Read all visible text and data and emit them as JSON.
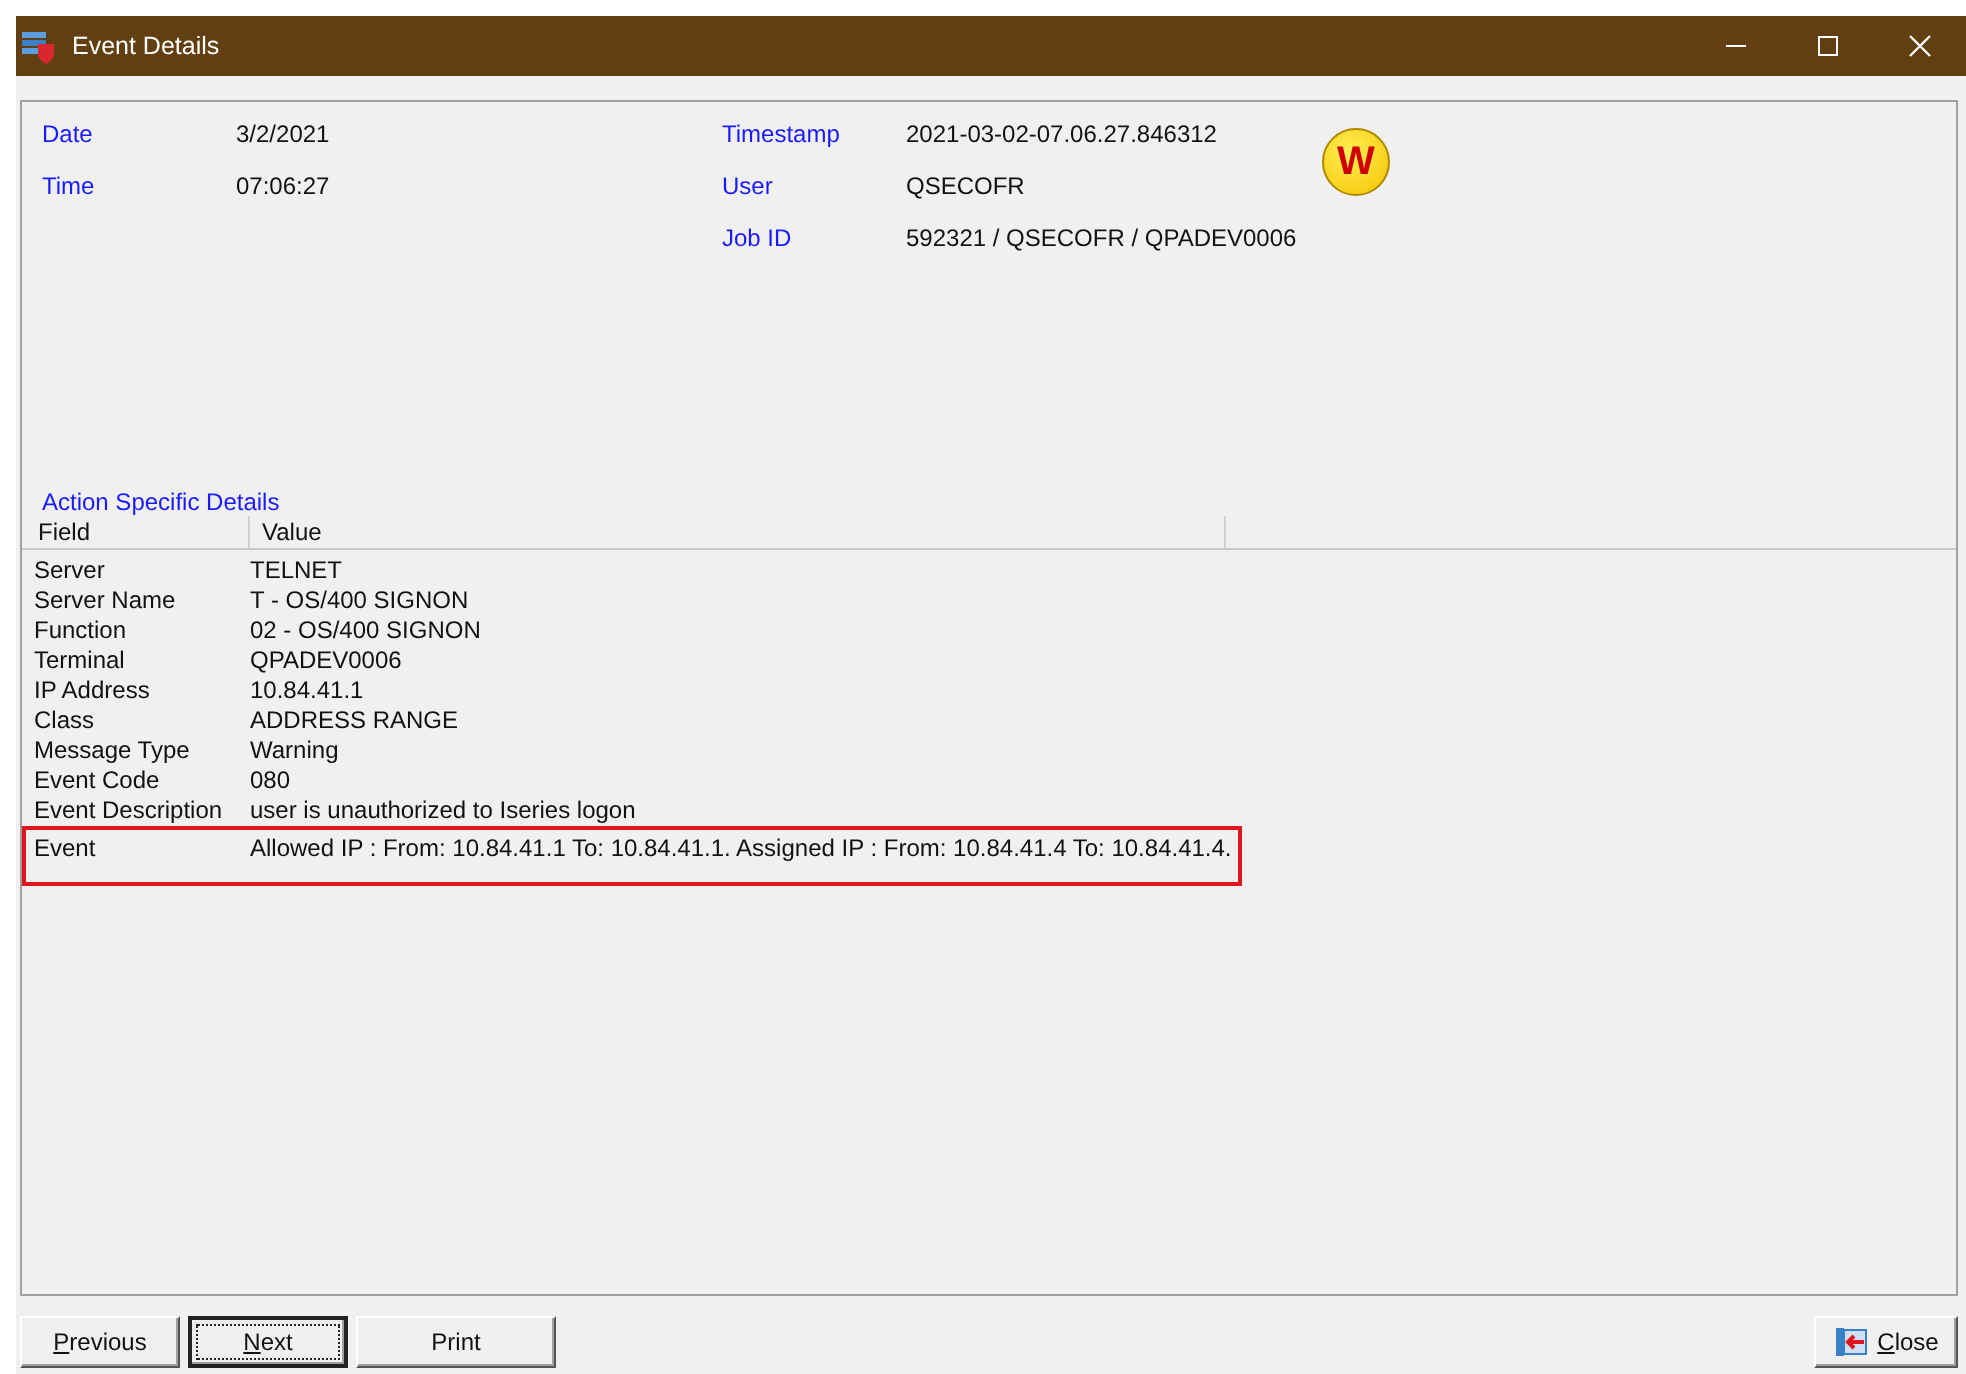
{
  "window": {
    "title": "Event Details"
  },
  "header": {
    "left": [
      {
        "label": "Date",
        "value": "3/2/2021"
      },
      {
        "label": "Time",
        "value": "07:06:27"
      }
    ],
    "right": [
      {
        "label": "Timestamp",
        "value": "2021-03-02-07.06.27.846312"
      },
      {
        "label": "User",
        "value": "QSECOFR"
      },
      {
        "label": "Job ID",
        "value": "592321 / QSECOFR / QPADEV0006"
      }
    ],
    "badge": "W"
  },
  "details": {
    "title": "Action Specific Details",
    "columns": [
      "Field",
      "Value"
    ],
    "rows": [
      {
        "field": "Server",
        "value": "TELNET",
        "highlighted": false
      },
      {
        "field": "Server Name",
        "value": "T - OS/400 SIGNON",
        "highlighted": false
      },
      {
        "field": "Function",
        "value": "02 - OS/400 SIGNON",
        "highlighted": false
      },
      {
        "field": "Terminal",
        "value": "QPADEV0006",
        "highlighted": false
      },
      {
        "field": "IP Address",
        "value": "10.84.41.1",
        "highlighted": false
      },
      {
        "field": "Class",
        "value": "ADDRESS RANGE",
        "highlighted": false
      },
      {
        "field": "Message Type",
        "value": "Warning",
        "highlighted": false
      },
      {
        "field": "Event Code",
        "value": "080",
        "highlighted": false
      },
      {
        "field": "Event Description",
        "value": "user is unauthorized to Iseries logon",
        "highlighted": false
      },
      {
        "field": "Event",
        "value": "Allowed IP : From: 10.84.41.1 To: 10.84.41.1. Assigned IP : From: 10.84.41.4 To: 10.84.41.4.",
        "highlighted": true
      }
    ]
  },
  "buttons": [
    {
      "accel": "P",
      "rest": "revious",
      "focused": false
    },
    {
      "accel": "N",
      "rest": "ext",
      "focused": true
    },
    {
      "rest": "Print",
      "focused": false
    }
  ],
  "close_button": {
    "accel": "C",
    "rest": "lose"
  }
}
